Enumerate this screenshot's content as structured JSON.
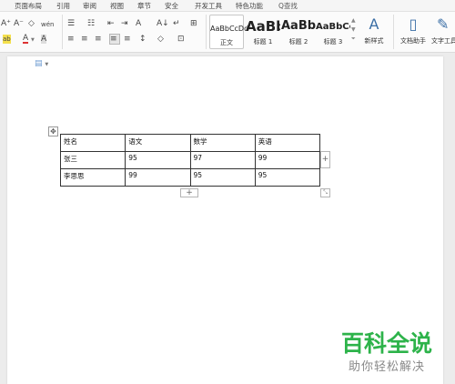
{
  "menu": {
    "items": [
      "页面布局",
      "引用",
      "审阅",
      "视图",
      "章节",
      "安全",
      "开发工具",
      "特色功能"
    ],
    "search": "Q查找"
  },
  "ribbon": {
    "font": {
      "grow": "A⁺",
      "shrink": "A⁻",
      "clear": "◇",
      "phonetic": "wén",
      "highlight": "ab",
      "font_color": "A",
      "char_shade": "A"
    },
    "paragraph": {
      "bullets": "☰",
      "numbering": "☷",
      "outdent": "⇤",
      "indent": "⇥",
      "chinese_layout": "A",
      "sort": "A↓",
      "show_marks": "↵",
      "borders": "⊞",
      "align_left": "≡",
      "align_center": "≡",
      "align_right": "≡",
      "justify": "≡",
      "distribute": "≡",
      "line_spacing": "↕",
      "shading": "◇",
      "para_borders": "⊡"
    },
    "styles": [
      {
        "sample": "AaBbCcDd",
        "name": "正文"
      },
      {
        "sample": "AaBb",
        "name": "标题 1"
      },
      {
        "sample": "AaBbC",
        "name": "标题 2"
      },
      {
        "sample": "AaBbCc",
        "name": "标题 3"
      }
    ],
    "new_style": {
      "icon": "A",
      "label": "新样式"
    },
    "doc_helper": {
      "label": "文档助手"
    },
    "text_tools": {
      "label": "文字工具"
    }
  },
  "table": {
    "rows": [
      [
        "姓名",
        "语文",
        "数学",
        "英语"
      ],
      [
        "张三",
        "95",
        "97",
        "99"
      ],
      [
        "李思思",
        "99",
        "95",
        "95"
      ]
    ]
  },
  "watermark": {
    "title": "百科全说",
    "subtitle": "助你轻松解决"
  },
  "colors": {
    "watermark_green": "#2db34a",
    "accent_blue": "#3a6ea5"
  }
}
